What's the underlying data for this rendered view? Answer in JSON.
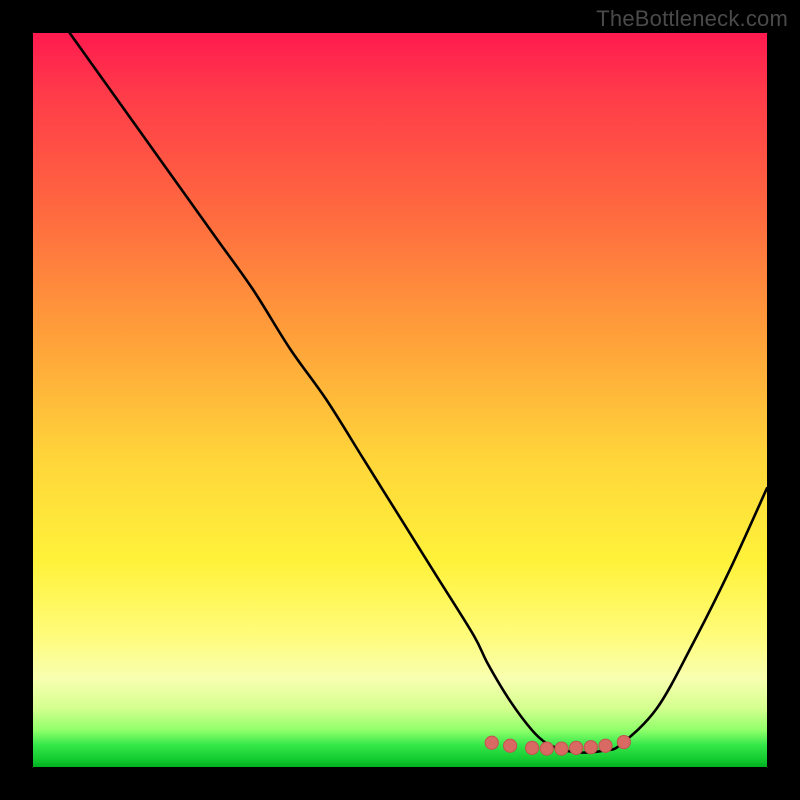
{
  "watermark": "TheBottleneck.com",
  "colors": {
    "frame": "#000000",
    "curve": "#000000",
    "marker_fill": "#d86a63",
    "marker_stroke": "#c25550"
  },
  "chart_data": {
    "type": "line",
    "title": "",
    "xlabel": "",
    "ylabel": "",
    "xlim": [
      0,
      100
    ],
    "ylim": [
      0,
      100
    ],
    "grid": false,
    "legend": false,
    "series": [
      {
        "name": "curve",
        "x": [
          5,
          10,
          15,
          20,
          25,
          30,
          35,
          40,
          45,
          50,
          55,
          60,
          62,
          65,
          68,
          70,
          72,
          74,
          76,
          78,
          80,
          85,
          90,
          95,
          100
        ],
        "values": [
          100,
          93,
          86,
          79,
          72,
          65,
          57,
          50,
          42,
          34,
          26,
          18,
          14,
          9,
          5,
          3.2,
          2.4,
          2.0,
          2.0,
          2.3,
          3.0,
          8,
          17,
          27,
          38
        ]
      }
    ],
    "markers": [
      {
        "x": 62.5,
        "y": 3.3
      },
      {
        "x": 65.0,
        "y": 2.9
      },
      {
        "x": 68.0,
        "y": 2.6
      },
      {
        "x": 70.0,
        "y": 2.5
      },
      {
        "x": 72.0,
        "y": 2.5
      },
      {
        "x": 74.0,
        "y": 2.6
      },
      {
        "x": 76.0,
        "y": 2.7
      },
      {
        "x": 78.0,
        "y": 2.9
      },
      {
        "x": 80.5,
        "y": 3.4
      }
    ],
    "marker_radius_pct": 0.9
  }
}
